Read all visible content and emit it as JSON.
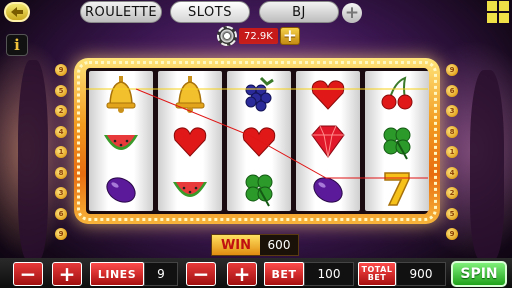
{
  "nav": {
    "tabs": [
      {
        "label": "ROULETTE"
      },
      {
        "label": "SLOTS"
      },
      {
        "label": "BJ"
      }
    ]
  },
  "balance": {
    "coins": "72.9K"
  },
  "info_label": "i",
  "paylines_left": [
    "9",
    "5",
    "2",
    "4",
    "1",
    "8",
    "3",
    "6",
    "9"
  ],
  "paylines_right": [
    "9",
    "6",
    "3",
    "8",
    "1",
    "4",
    "2",
    "5",
    "9"
  ],
  "reels": [
    [
      "bell-icon",
      "watermelon-icon",
      "plum-icon"
    ],
    [
      "bell-icon",
      "heart-icon",
      "watermelon-icon"
    ],
    [
      "grapes-icon",
      "heart-icon",
      "clover-icon"
    ],
    [
      "heart-icon",
      "diamond-icon",
      "plum-icon"
    ],
    [
      "cherries-icon",
      "clover-icon",
      "seven-icon"
    ]
  ],
  "win": {
    "label": "WIN",
    "value": "600"
  },
  "controls": {
    "minus_label": "−",
    "plus_label": "+",
    "lines_label": "LINES",
    "lines_value": "9",
    "bet_label": "BET",
    "bet_value": "100",
    "total_bet_label_1": "TOTAL",
    "total_bet_label_2": "BET",
    "total_bet_value": "900",
    "spin_label": "SPIN"
  },
  "colors": {
    "accent_red": "#c61a1a",
    "spin_green": "#1fa21a",
    "frame_orange": "#f29a20"
  }
}
